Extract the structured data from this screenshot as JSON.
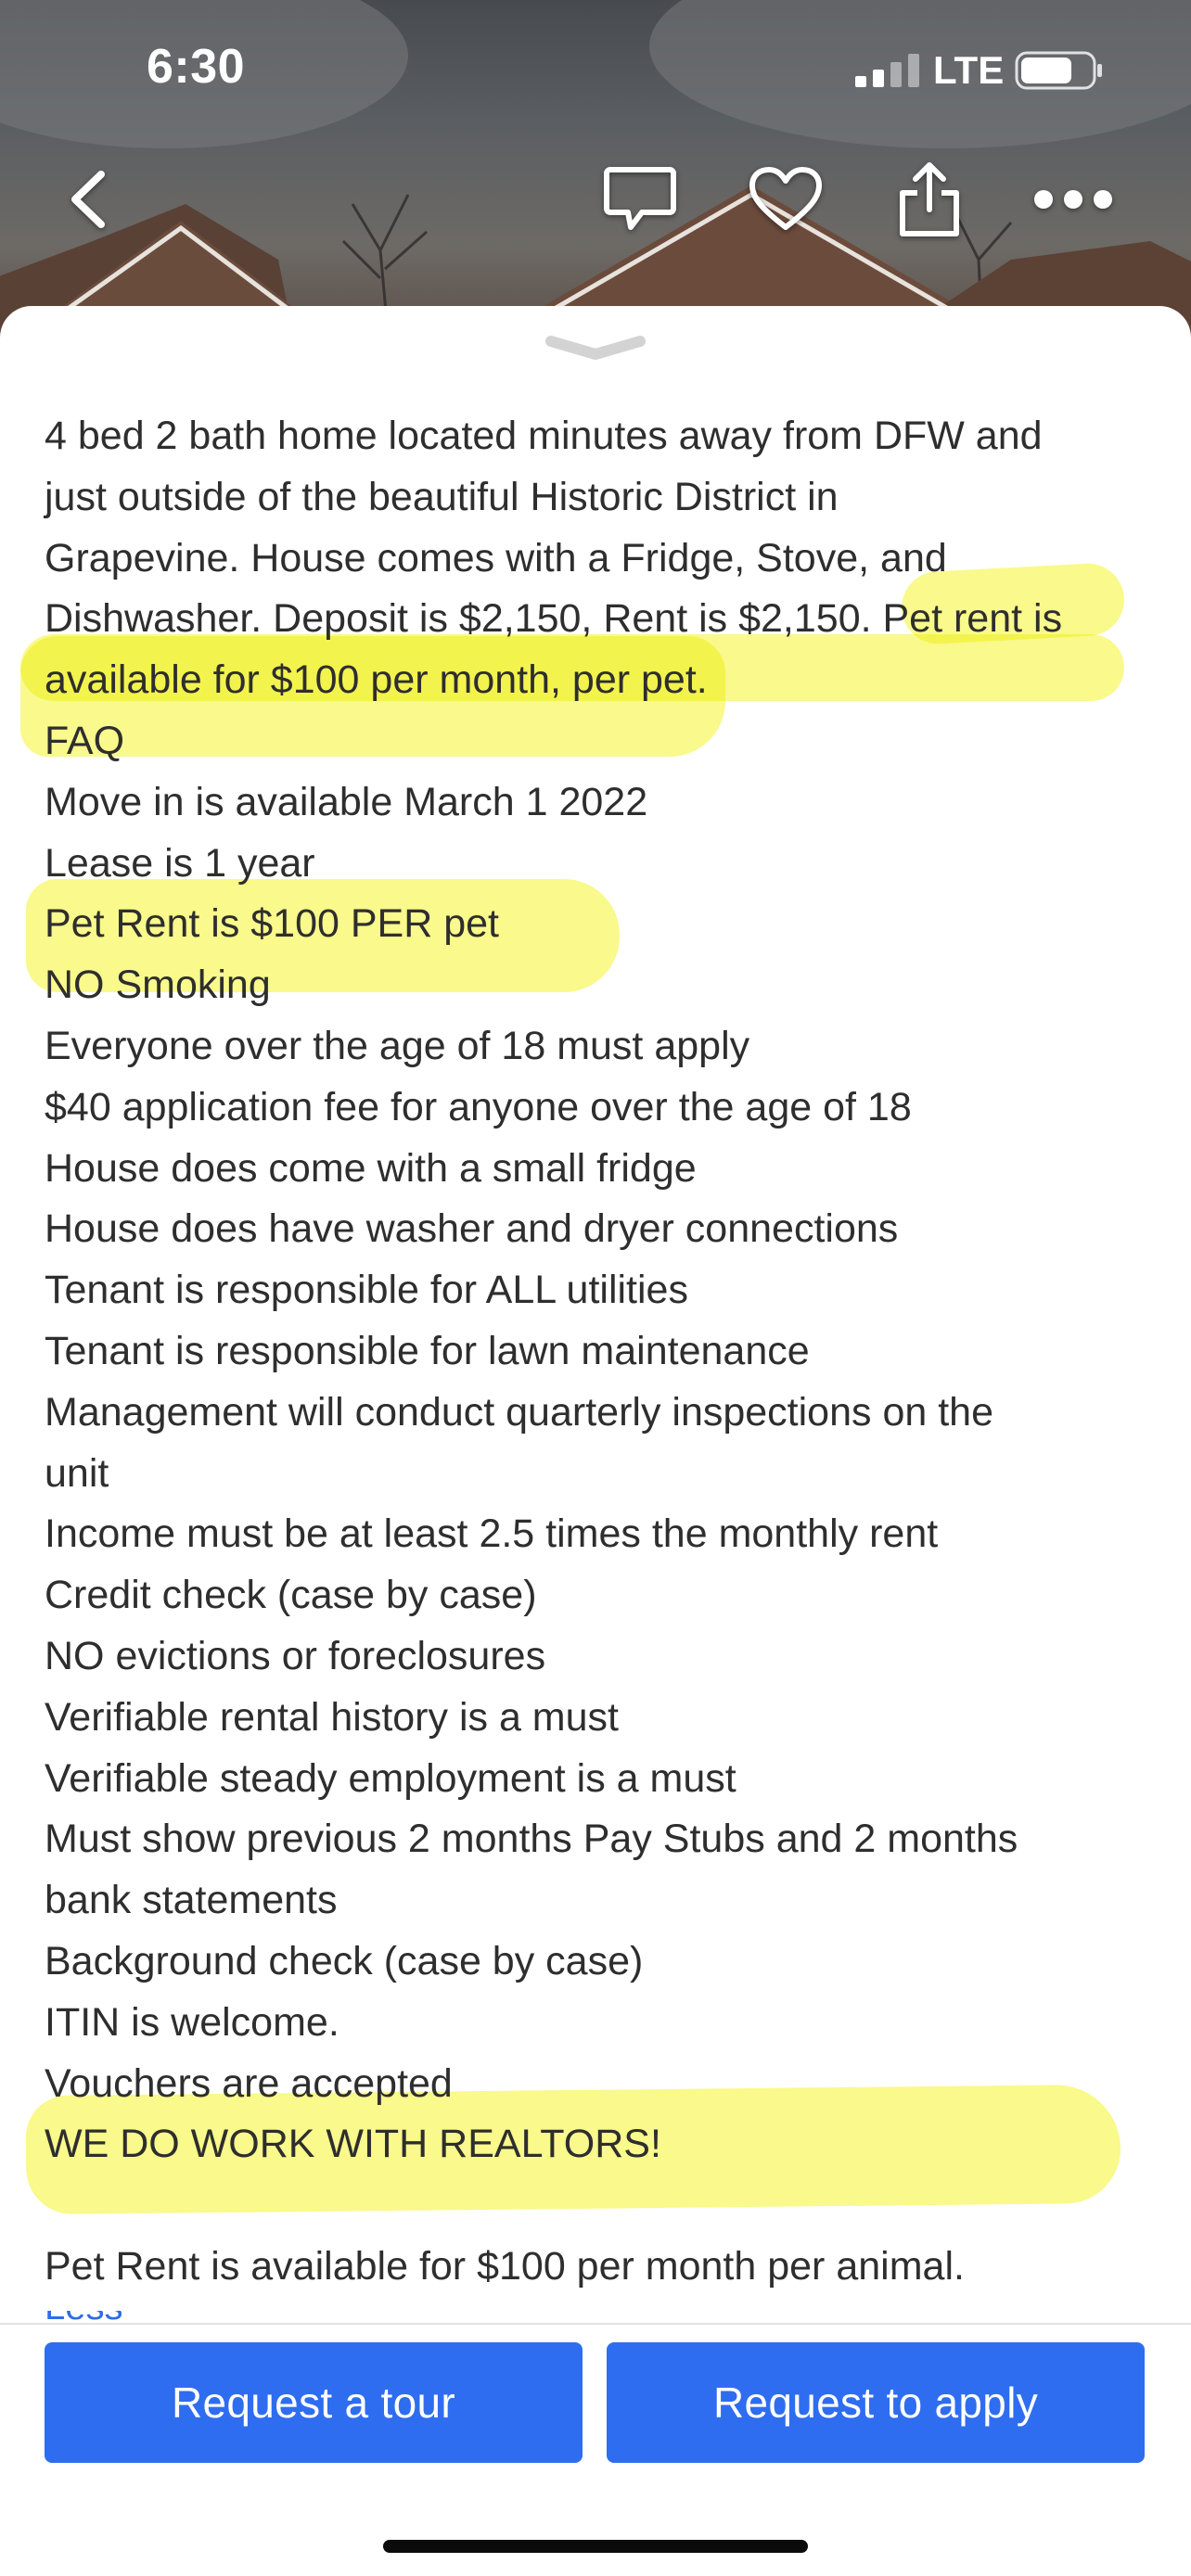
{
  "status_bar": {
    "time": "6:30",
    "network": "LTE",
    "signal_icon": "cellular-signal-icon",
    "battery_icon": "battery-icon"
  },
  "top_nav": {
    "back_icon": "chevron-left-icon",
    "message_icon": "chat-bubble-icon",
    "favorite_icon": "heart-icon",
    "share_icon": "share-icon",
    "more_icon": "ellipsis-icon"
  },
  "listing": {
    "description_lines": [
      "4 bed 2 bath home located minutes away from DFW and",
      "just outside of the beautiful Historic District in",
      "Grapevine. House comes with a Fridge, Stove, and",
      "Dishwasher. Deposit is $2,150, Rent is $2,150. Pet rent is",
      "available for $100 per month, per pet.",
      "FAQ",
      "Move in is available March 1 2022",
      "Lease is 1 year",
      "Pet Rent is $100 PER pet",
      "NO Smoking",
      "Everyone over the age of 18 must apply",
      "$40 application fee for anyone over the age of 18",
      "House does come with a small fridge",
      "House does have washer and dryer connections",
      "Tenant is responsible for ALL utilities",
      "Tenant is responsible for lawn maintenance",
      "Management will conduct quarterly inspections on the",
      "unit",
      "Income must be at least 2.5 times the monthly rent",
      "Credit check (case by case)",
      "NO evictions or foreclosures",
      "Verifiable rental history is a must",
      "Verifiable steady employment is a must",
      "Must show previous 2 months Pay Stubs and 2 months",
      "bank statements",
      "Background check (case by case)",
      "ITIN is welcome.",
      "Vouchers are accepted",
      "WE DO WORK WITH REALTORS!"
    ],
    "closing_line": "Pet Rent is available for $100 per month per animal.",
    "less_link": "Less"
  },
  "actions": {
    "tour_label": "Request a tour",
    "apply_label": "Request to apply",
    "accent_color": "#2f6df0"
  },
  "highlight_color": "#f6f546"
}
